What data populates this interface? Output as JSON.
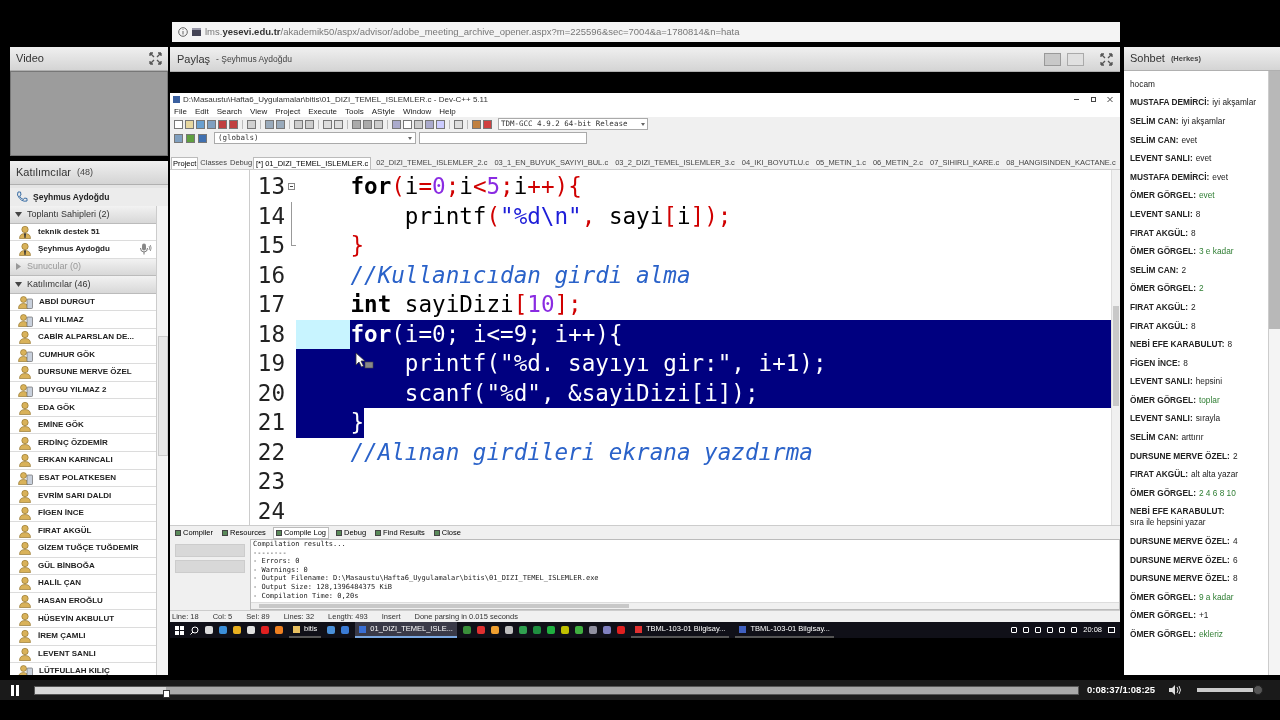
{
  "browser": {
    "url": "lms.**yesevi.edu.tr**/akademik50/aspx/advisor/adobe_meeting_archive_opener.aspx?m=225596&sec=7004&a=1780814&n=hata"
  },
  "video": {
    "title": "Video"
  },
  "attendees": {
    "title": "Katılımcılar",
    "count": "(48)",
    "presenter": "Şeyhmus Aydoğdu",
    "groups": [
      {
        "label": "Toplantı Sahipleri (2)",
        "expanded": true,
        "disabled": false,
        "members": [
          {
            "name": "teknik destek 51",
            "kind": "host",
            "speaking": false
          },
          {
            "name": "Şeyhmus Aydoğdu",
            "kind": "host",
            "speaking": true
          }
        ]
      },
      {
        "label": "Sunucular (0)",
        "expanded": false,
        "disabled": true
      },
      {
        "label": "Katılımcılar (46)",
        "expanded": true,
        "disabled": false,
        "members": [
          {
            "name": "ABDİ DURGUT",
            "kind": "device",
            "speaking": false
          },
          {
            "name": "ALİ YILMAZ",
            "kind": "device",
            "speaking": false
          },
          {
            "name": "CABİR ALPARSLAN DE...",
            "kind": "person",
            "speaking": false
          },
          {
            "name": "CUMHUR GÖK",
            "kind": "device",
            "speaking": false
          },
          {
            "name": "DURSUNE MERVE ÖZEL",
            "kind": "person",
            "speaking": false
          },
          {
            "name": "DUYGU YILMAZ 2",
            "kind": "device",
            "speaking": false
          },
          {
            "name": "EDA GÖK",
            "kind": "person",
            "speaking": false
          },
          {
            "name": "EMİNE GÖK",
            "kind": "person",
            "speaking": false
          },
          {
            "name": "ERDİNÇ ÖZDEMİR",
            "kind": "person",
            "speaking": false
          },
          {
            "name": "ERKAN KARINCALI",
            "kind": "person",
            "speaking": false
          },
          {
            "name": "ESAT POLATKESEN",
            "kind": "device",
            "speaking": false
          },
          {
            "name": "EVRİM SARI DALDI",
            "kind": "person",
            "speaking": false
          },
          {
            "name": "FİGEN İNCE",
            "kind": "person",
            "speaking": false
          },
          {
            "name": "FIRAT AKGÜL",
            "kind": "person",
            "speaking": false
          },
          {
            "name": "GİZEM TUĞÇE TUĞDEMİR",
            "kind": "person",
            "speaking": false
          },
          {
            "name": "GÜL BİNBOĞA",
            "kind": "person",
            "speaking": false
          },
          {
            "name": "HALİL ÇAN",
            "kind": "person",
            "speaking": false
          },
          {
            "name": "HASAN EROĞLU",
            "kind": "person",
            "speaking": false
          },
          {
            "name": "HÜSEYİN AKBULUT",
            "kind": "person",
            "speaking": false
          },
          {
            "name": "İREM ÇAMLI",
            "kind": "person",
            "speaking": false
          },
          {
            "name": "LEVENT SANLI",
            "kind": "person",
            "speaking": false
          },
          {
            "name": "LÜTFULLAH KILIÇ",
            "kind": "device",
            "speaking": false
          }
        ]
      }
    ]
  },
  "share": {
    "title": "Paylaş",
    "presenter": "- Şeyhmus Aydoğdu"
  },
  "ide": {
    "title": "D:\\Masaustu\\Hafta6_Uygulamalar\\bitis\\01_DIZI_TEMEL_ISLEMLER.c - Dev-C++ 5.11",
    "menu": [
      "File",
      "Edit",
      "Search",
      "View",
      "Project",
      "Execute",
      "Tools",
      "AStyle",
      "Window",
      "Help"
    ],
    "compiler": "TDM-GCC 4.9.2 64-bit Release",
    "scope": "(globals)",
    "side_tabs": [
      {
        "label": "Project",
        "selected": true
      },
      {
        "label": "Classes",
        "selected": false
      },
      {
        "label": "Debug",
        "selected": false
      }
    ],
    "file_tabs": [
      {
        "label": "[*] 01_DIZI_TEMEL_ISLEMLER.c",
        "selected": true
      },
      {
        "label": "02_DIZI_TEMEL_ISLEMLER_2.c",
        "selected": false
      },
      {
        "label": "03_1_EN_BUYUK_SAYIYI_BUL.c",
        "selected": false
      },
      {
        "label": "03_2_DIZI_TEMEL_ISLEMLER_3.c",
        "selected": false
      },
      {
        "label": "04_IKI_BOYUTLU.c",
        "selected": false
      },
      {
        "label": "05_METIN_1.c",
        "selected": false
      },
      {
        "label": "06_METIN_2.c",
        "selected": false
      },
      {
        "label": "07_SIHIRLI_KARE.c",
        "selected": false
      },
      {
        "label": "08_HANGISINDEN_KACTANE.c",
        "selected": false
      }
    ],
    "lines": [
      {
        "number": "13",
        "current": false,
        "selected": false,
        "fold_start": true,
        "fold_end": false,
        "segments": [
          {
            "kind": "keyword",
            "text": "for"
          },
          {
            "kind": "symbol",
            "text": "("
          },
          {
            "kind": "plain",
            "text": "i"
          },
          {
            "kind": "symbol",
            "text": "="
          },
          {
            "kind": "number",
            "text": "0"
          },
          {
            "kind": "symbol",
            "text": ";"
          },
          {
            "kind": "plain",
            "text": "i"
          },
          {
            "kind": "symbol",
            "text": "<"
          },
          {
            "kind": "number",
            "text": "5"
          },
          {
            "kind": "symbol",
            "text": ";"
          },
          {
            "kind": "plain",
            "text": "i"
          },
          {
            "kind": "symbol",
            "text": "++){"
          }
        ],
        "children": [
          {
            "number": "14",
            "current": false,
            "selected": false,
            "fold_start": false,
            "fold_end": false,
            "segments": [
              {
                "kind": "plain",
                "text": "printf"
              },
              {
                "kind": "symbol",
                "text": "("
              },
              {
                "kind": "string",
                "text": "\"%d\\n\""
              },
              {
                "kind": "symbol",
                "text": ","
              },
              {
                "kind": "plain",
                "text": " sayi"
              },
              {
                "kind": "symbol",
                "text": "["
              },
              {
                "kind": "plain",
                "text": "i"
              },
              {
                "kind": "symbol",
                "text": "]);"
              }
            ]
          }
        ]
      },
      {
        "number": "15",
        "current": false,
        "selected": false,
        "fold_start": false,
        "fold_end": true,
        "segments": [
          {
            "kind": "symbol",
            "text": "}"
          }
        ]
      },
      {
        "number": "16",
        "current": false,
        "selected": false,
        "fold_start": false,
        "fold_end": false,
        "segments": [
          {
            "kind": "comment",
            "text": "//Kullanıcıdan girdi alma"
          }
        ]
      },
      {
        "number": "17",
        "current": false,
        "selected": false,
        "fold_start": false,
        "fold_end": false,
        "segments": [
          {
            "kind": "keyword",
            "text": "int"
          },
          {
            "kind": "plain",
            "text": " sayiDizi"
          },
          {
            "kind": "symbol",
            "text": "["
          },
          {
            "kind": "number",
            "text": "10"
          },
          {
            "kind": "symbol",
            "text": "];"
          }
        ]
      },
      {
        "number": "18",
        "current": true,
        "selected": true,
        "fold_start": false,
        "fold_end": false,
        "segments": [
          {
            "kind": "keyword",
            "text": "for"
          },
          {
            "kind": "symbol",
            "text": "("
          },
          {
            "kind": "plain",
            "text": "i"
          },
          {
            "kind": "symbol",
            "text": "="
          },
          {
            "kind": "number",
            "text": "0"
          },
          {
            "kind": "symbol",
            "text": ";"
          },
          {
            "kind": "plain",
            "text": " i"
          },
          {
            "kind": "symbol",
            "text": "<="
          },
          {
            "kind": "number",
            "text": "9"
          },
          {
            "kind": "symbol",
            "text": ";"
          },
          {
            "kind": "plain",
            "text": " i"
          },
          {
            "kind": "symbol",
            "text": "++){"
          }
        ],
        "children": [
          {
            "number": "19",
            "current": false,
            "selected": true,
            "fold_start": false,
            "fold_end": false,
            "segments": [
              {
                "kind": "plain",
                "text": "printf"
              },
              {
                "kind": "symbol",
                "text": "("
              },
              {
                "kind": "string",
                "text": "\"%d. sayıyı gir:\""
              },
              {
                "kind": "symbol",
                "text": ","
              },
              {
                "kind": "plain",
                "text": " i"
              },
              {
                "kind": "symbol",
                "text": "+"
              },
              {
                "kind": "number",
                "text": "1"
              },
              {
                "kind": "symbol",
                "text": ");"
              }
            ]
          },
          {
            "number": "20",
            "current": false,
            "selected": true,
            "fold_start": false,
            "fold_end": false,
            "segments": [
              {
                "kind": "plain",
                "text": "scanf"
              },
              {
                "kind": "symbol",
                "text": "("
              },
              {
                "kind": "string",
                "text": "\"%d\""
              },
              {
                "kind": "symbol",
                "text": ", &"
              },
              {
                "kind": "plain",
                "text": "sayiDizi"
              },
              {
                "kind": "symbol",
                "text": "["
              },
              {
                "kind": "plain",
                "text": "i"
              },
              {
                "kind": "symbol",
                "text": "]);"
              }
            ]
          }
        ]
      },
      {
        "number": "21",
        "current": false,
        "selected": true,
        "fold_start": false,
        "fold_end": false,
        "segments": [
          {
            "kind": "symbol",
            "text": "}"
          }
        ]
      },
      {
        "number": "22",
        "current": false,
        "selected": false,
        "fold_start": false,
        "fold_end": false,
        "segments": [
          {
            "kind": "comment",
            "text": "//Alınan girdileri ekrana yazdırma"
          }
        ]
      },
      {
        "number": "23",
        "current": false,
        "selected": false,
        "fold_start": false,
        "fold_end": false
      },
      {
        "number": "24",
        "current": false,
        "selected": false,
        "fold_start": false,
        "fold_end": false
      }
    ],
    "bottom_tabs": [
      {
        "label": "Compiler",
        "selected": false
      },
      {
        "label": "Resources",
        "selected": false
      },
      {
        "label": "Compile Log",
        "selected": true
      },
      {
        "label": "Debug",
        "selected": false
      },
      {
        "label": "Find Results",
        "selected": false
      },
      {
        "label": "Close",
        "selected": false
      }
    ],
    "log": [
      "Compilation results...",
      "--------",
      "- Errors: 0",
      "- Warnings: 0",
      "- Output Filename: D:\\Masaustu\\Hafta6_Uygulamalar\\bitis\\01_DIZI_TEMEL_ISLEMLER.exe",
      "- Output Size: 128,1396484375 KiB",
      "- Compilation Time: 0,20s"
    ],
    "status": [
      "Line: 18",
      "Col: 5",
      "Sel: 89",
      "Lines: 32",
      "Length: 493",
      "Insert",
      "Done parsing in 0.015 seconds"
    ]
  },
  "taskbar": {
    "items": [
      {
        "kind": "start"
      },
      {
        "kind": "search"
      },
      {
        "kind": "icon",
        "color": "#dddddd"
      },
      {
        "kind": "icon",
        "color": "#3b8fd9"
      },
      {
        "kind": "icon",
        "color": "#e8b020"
      },
      {
        "kind": "icon",
        "color": "#e0e0e0"
      },
      {
        "kind": "icon",
        "color": "#e02020"
      },
      {
        "kind": "icon",
        "color": "#f08020"
      },
      {
        "kind": "app",
        "color": "#e8c060",
        "label": "bitis",
        "selected": false
      },
      {
        "kind": "icon",
        "color": "#4a90d9"
      },
      {
        "kind": "icon",
        "color": "#3a7bd5"
      },
      {
        "kind": "app",
        "color": "#3a6fd5",
        "label": "01_DIZI_TEMEL_ISLE...",
        "selected": true
      },
      {
        "kind": "icon",
        "color": "#3a8f3a"
      },
      {
        "kind": "icon",
        "color": "#e03030"
      },
      {
        "kind": "icon",
        "color": "#f0a030"
      },
      {
        "kind": "icon",
        "color": "#c0c0c0"
      },
      {
        "kind": "icon",
        "color": "#30a050"
      },
      {
        "kind": "icon",
        "color": "#1f8f40"
      },
      {
        "kind": "icon",
        "color": "#20b040"
      },
      {
        "kind": "icon",
        "color": "#c0c000"
      },
      {
        "kind": "icon",
        "color": "#40b040"
      },
      {
        "kind": "icon",
        "color": "#9090a0"
      },
      {
        "kind": "icon",
        "color": "#8080c0"
      },
      {
        "kind": "icon",
        "color": "#e02020"
      },
      {
        "kind": "app",
        "color": "#e03030",
        "label": "TBML-103-01 Bilgisay...",
        "selected": false
      },
      {
        "kind": "app",
        "color": "#4060c0",
        "label": "TBML-103-01 Bilgisay...",
        "selected": false
      }
    ],
    "clock": "20:08"
  },
  "chat": {
    "title": "Sohbet",
    "audience": "(Herkes)",
    "messages": [
      {
        "text": "hocam",
        "highlighted": false
      },
      {
        "sender": "MUSTAFA DEMİRCİ:",
        "text": "iyi akşamlar",
        "highlighted": false
      },
      {
        "sender": "SELİM CAN:",
        "text": "iyi akşamlar",
        "highlighted": false
      },
      {
        "sender": "SELİM CAN:",
        "text": "evet",
        "highlighted": false
      },
      {
        "sender": "LEVENT SANLI:",
        "text": "evet",
        "highlighted": false
      },
      {
        "sender": "MUSTAFA DEMİRCİ:",
        "text": "evet",
        "highlighted": false
      },
      {
        "sender": "ÖMER GÖRGEL:",
        "text": "evet",
        "highlighted": true
      },
      {
        "sender": "LEVENT SANLI:",
        "text": "8",
        "highlighted": false
      },
      {
        "sender": "FIRAT AKGÜL:",
        "text": "8",
        "highlighted": false
      },
      {
        "sender": "ÖMER GÖRGEL:",
        "text": "3 e kadar",
        "highlighted": true
      },
      {
        "sender": "SELİM CAN:",
        "text": "2",
        "highlighted": false
      },
      {
        "sender": "ÖMER GÖRGEL:",
        "text": "2",
        "highlighted": true
      },
      {
        "sender": "FIRAT AKGÜL:",
        "text": "2",
        "highlighted": false
      },
      {
        "sender": "FIRAT AKGÜL:",
        "text": "8",
        "highlighted": false
      },
      {
        "sender": "NEBİ EFE KARABULUT:",
        "text": "8",
        "highlighted": false
      },
      {
        "sender": "FİGEN İNCE:",
        "text": "8",
        "highlighted": false
      },
      {
        "sender": "LEVENT SANLI:",
        "text": "hepsini",
        "highlighted": false
      },
      {
        "sender": "ÖMER GÖRGEL:",
        "text": "toplar",
        "highlighted": true
      },
      {
        "sender": "LEVENT SANLI:",
        "text": "sırayla",
        "highlighted": false
      },
      {
        "sender": "SELİM CAN:",
        "text": "arttırır",
        "highlighted": false
      },
      {
        "sender": "DURSUNE MERVE ÖZEL:",
        "text": "2",
        "highlighted": false
      },
      {
        "sender": "FIRAT AKGÜL:",
        "text": "alt alta yazar",
        "highlighted": false
      },
      {
        "sender": "ÖMER GÖRGEL:",
        "text": "2 4 6 8 10",
        "highlighted": true
      },
      {
        "sender": "NEBİ EFE KARABULUT:",
        "text": "sıra ile hepsini yazar",
        "highlighted": false
      },
      {
        "sender": "DURSUNE MERVE ÖZEL:",
        "text": "4",
        "highlighted": false
      },
      {
        "sender": "DURSUNE MERVE ÖZEL:",
        "text": "6",
        "highlighted": false
      },
      {
        "sender": "DURSUNE MERVE ÖZEL:",
        "text": "8",
        "highlighted": false
      },
      {
        "sender": "ÖMER GÖRGEL:",
        "text": "9 a kadar",
        "highlighted": true
      },
      {
        "sender": "ÖMER GÖRGEL:",
        "text": "+1",
        "highlighted": false
      },
      {
        "sender": "ÖMER GÖRGEL:",
        "text": "ekleriz",
        "highlighted": true
      }
    ]
  },
  "player": {
    "playing": true,
    "level": 0.126,
    "time": "0:08:37/1:08:25",
    "volume": {
      "level": 1
    }
  }
}
